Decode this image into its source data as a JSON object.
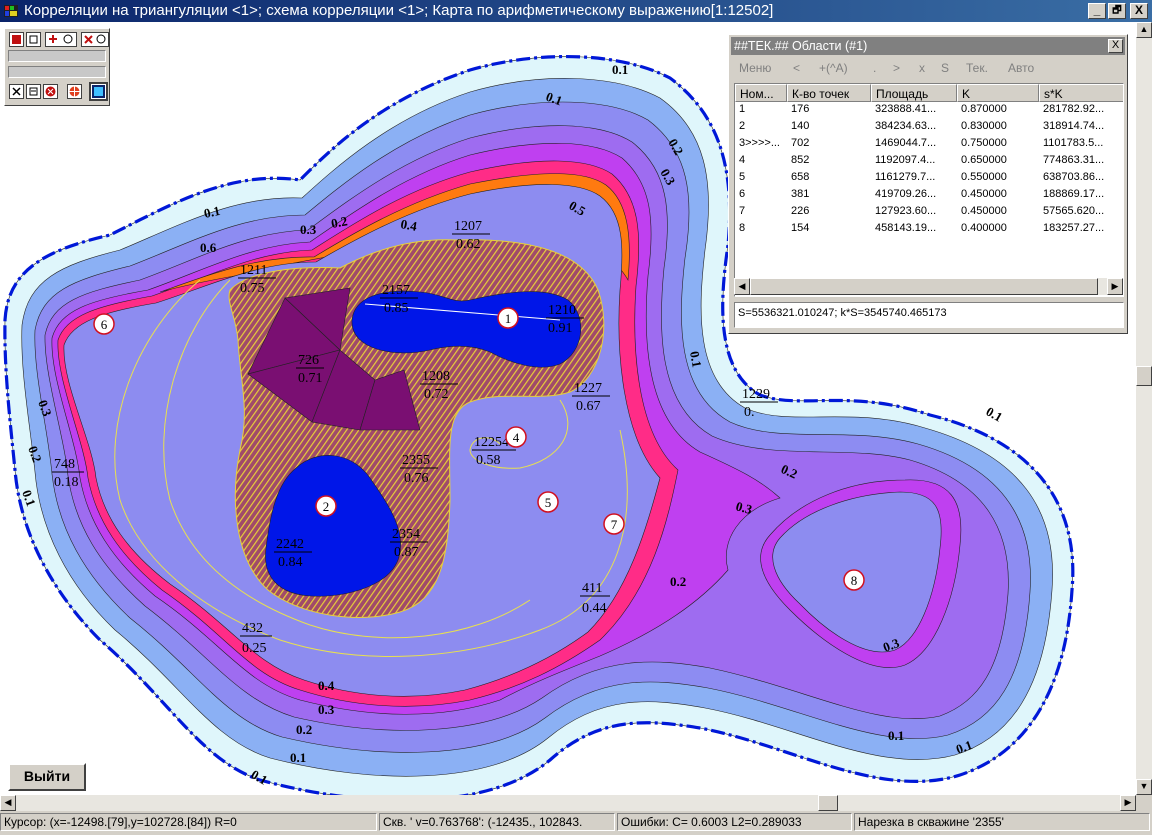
{
  "window": {
    "title": "Корреляции на триангуляции <1>; схема корреляции <1>; Карта по арифметическому выражению[1:12502]",
    "minimize": "_",
    "maximize": "🗗",
    "close": "X"
  },
  "map": {
    "colors": {
      "band_01": "#dff6fb",
      "band_02": "#8bb0f4",
      "band_03": "#8d8cf2",
      "band_04": "#9e6cf0",
      "band_05": "#bf40f0",
      "band_06": "#ff2c87",
      "band_07": "#ff7a10",
      "inner": "#8d8cf0",
      "core": "#0016e8",
      "hatch": "#e7cf3a",
      "hatch_bg": "#a04a6a",
      "triangle": "#7a0f72",
      "boundary": "#0018d8"
    },
    "contour_labels": [
      {
        "text": "0.1"
      },
      {
        "text": "0.1"
      },
      {
        "text": "0.1"
      },
      {
        "text": "0.1"
      },
      {
        "text": "0.1"
      },
      {
        "text": "0.1"
      },
      {
        "text": "0.1"
      },
      {
        "text": "0.1"
      },
      {
        "text": "0.1"
      },
      {
        "text": "0.2"
      },
      {
        "text": "0.2"
      },
      {
        "text": "0.2"
      },
      {
        "text": "0.2"
      },
      {
        "text": "0.2"
      },
      {
        "text": "0.2"
      },
      {
        "text": "0.3"
      },
      {
        "text": "0.3"
      },
      {
        "text": "0.3"
      },
      {
        "text": "0.3"
      },
      {
        "text": "0.3"
      },
      {
        "text": "0.3"
      },
      {
        "text": "0.4"
      },
      {
        "text": "0.4"
      },
      {
        "text": "0.5"
      },
      {
        "text": "0.6"
      },
      {
        "text": "0.1"
      }
    ],
    "wells": [
      {
        "num": "1211",
        "val": "0.75"
      },
      {
        "num": "2157",
        "val": "0.85"
      },
      {
        "num": "1210",
        "val": "0.91"
      },
      {
        "num": "1207",
        "val": "0.62"
      },
      {
        "num": "726",
        "val": "0.71"
      },
      {
        "num": "1208",
        "val": "0.72"
      },
      {
        "num": "1227",
        "val": "0.67"
      },
      {
        "num": "1229",
        "val": "0."
      },
      {
        "num": "12254",
        "val": "0.58"
      },
      {
        "num": "2355",
        "val": "0.76"
      },
      {
        "num": "748",
        "val": "0.18"
      },
      {
        "num": "2242",
        "val": "0.84"
      },
      {
        "num": "2354",
        "val": "0.87"
      },
      {
        "num": "411",
        "val": "0.44"
      },
      {
        "num": "432",
        "val": "0.25"
      }
    ],
    "region_markers": [
      "1",
      "2",
      "4",
      "5",
      "6",
      "7",
      "8"
    ]
  },
  "panel": {
    "title": "##ТЕК.## Области (#1)",
    "close": "X",
    "menu": [
      "Меню",
      "<",
      "+(^A)",
      ".",
      ">",
      "x",
      "S",
      "Тек.",
      "Авто"
    ],
    "columns": [
      "Ном...",
      "К-во точек",
      "Площадь",
      "K",
      "s*K"
    ],
    "rows": [
      [
        "1",
        "176",
        "323888.41...",
        "0.870000",
        "281782.92..."
      ],
      [
        "2",
        "140",
        "384234.63...",
        "0.830000",
        "318914.74..."
      ],
      [
        "3>>>>...",
        "702",
        "1469044.7...",
        "0.750000",
        "1101783.5..."
      ],
      [
        "4",
        "852",
        "1192097.4...",
        "0.650000",
        "774863.31..."
      ],
      [
        "5",
        "658",
        "1161279.7...",
        "0.550000",
        "638703.86..."
      ],
      [
        "6",
        "381",
        "419709.26...",
        "0.450000",
        "188869.17..."
      ],
      [
        "7",
        "226",
        "127923.60...",
        "0.450000",
        "57565.620..."
      ],
      [
        "8",
        "154",
        "458143.19...",
        "0.400000",
        "183257.27..."
      ]
    ],
    "summary": "S=5536321.010247; k*S=3545740.465173"
  },
  "exit_button": "Выйти",
  "status": {
    "cursor": "Курсор: (x=-12498.[79],y=102728.[84]) R=0",
    "well": "Скв. ' v=0.763768': (-12435., 102843.",
    "errors": "Ошибки: C=  0.6003 L2=0.289033",
    "cut": "Нарезка в скважине '2355'"
  }
}
